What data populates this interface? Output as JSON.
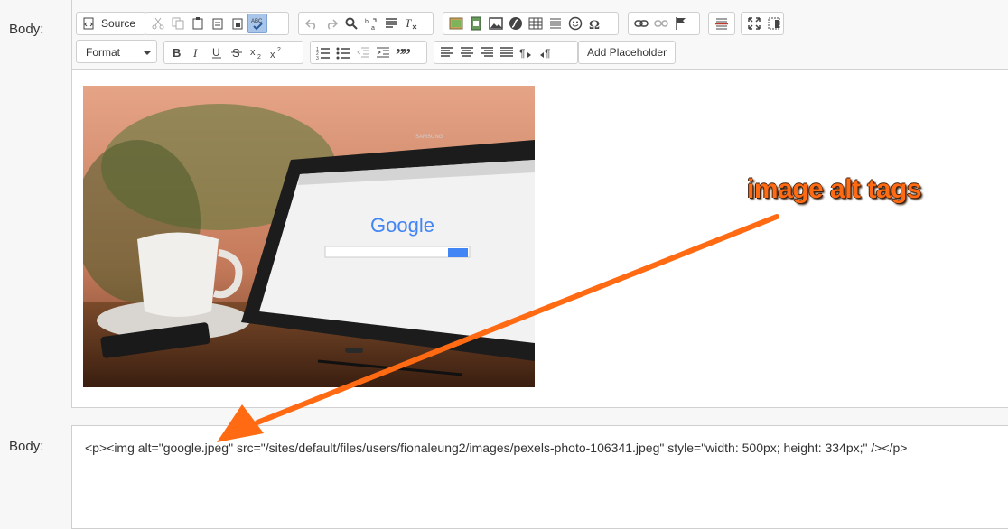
{
  "labels": {
    "body_top": "Body:",
    "body_bottom": "Body:"
  },
  "toolbar": {
    "source_label": "Source",
    "format_label": "Format",
    "placeholder_label": "Add Placeholder",
    "icons_row1": [
      "source-icon",
      "cut-icon",
      "copy-icon",
      "paste-icon",
      "paste-text-icon",
      "paste-word-icon",
      "spellcheck-icon",
      "undo-icon",
      "redo-icon",
      "find-icon",
      "replace-icon",
      "select-all-icon",
      "remove-format-icon",
      "image-icon",
      "media-icon",
      "picture-icon",
      "flash-icon",
      "table-icon",
      "horizontal-line-icon",
      "smiley-icon",
      "special-char-icon",
      "link-icon",
      "unlink-icon",
      "anchor-icon",
      "template-icon",
      "maximize-icon",
      "show-blocks-icon"
    ],
    "icons_row2": [
      "bold-icon",
      "italic-icon",
      "underline-icon",
      "strike-icon",
      "subscript-icon",
      "superscript-icon",
      "numbered-list-icon",
      "bulleted-list-icon",
      "outdent-icon",
      "indent-icon",
      "blockquote-icon",
      "align-left-icon",
      "align-center-icon",
      "align-right-icon",
      "justify-icon",
      "ltr-icon",
      "rtl-icon"
    ]
  },
  "image": {
    "brand": "SAMSUNG",
    "logo": "Google"
  },
  "source_code": "<p><img alt=\"google.jpeg\" src=\"/sites/default/files/users/fionaleung2/images/pexels-photo-106341.jpeg\" style=\"width: 500px; height: 334px;\" /></p>",
  "annotation": {
    "text": "image alt tags",
    "color": "#ff6a13"
  }
}
